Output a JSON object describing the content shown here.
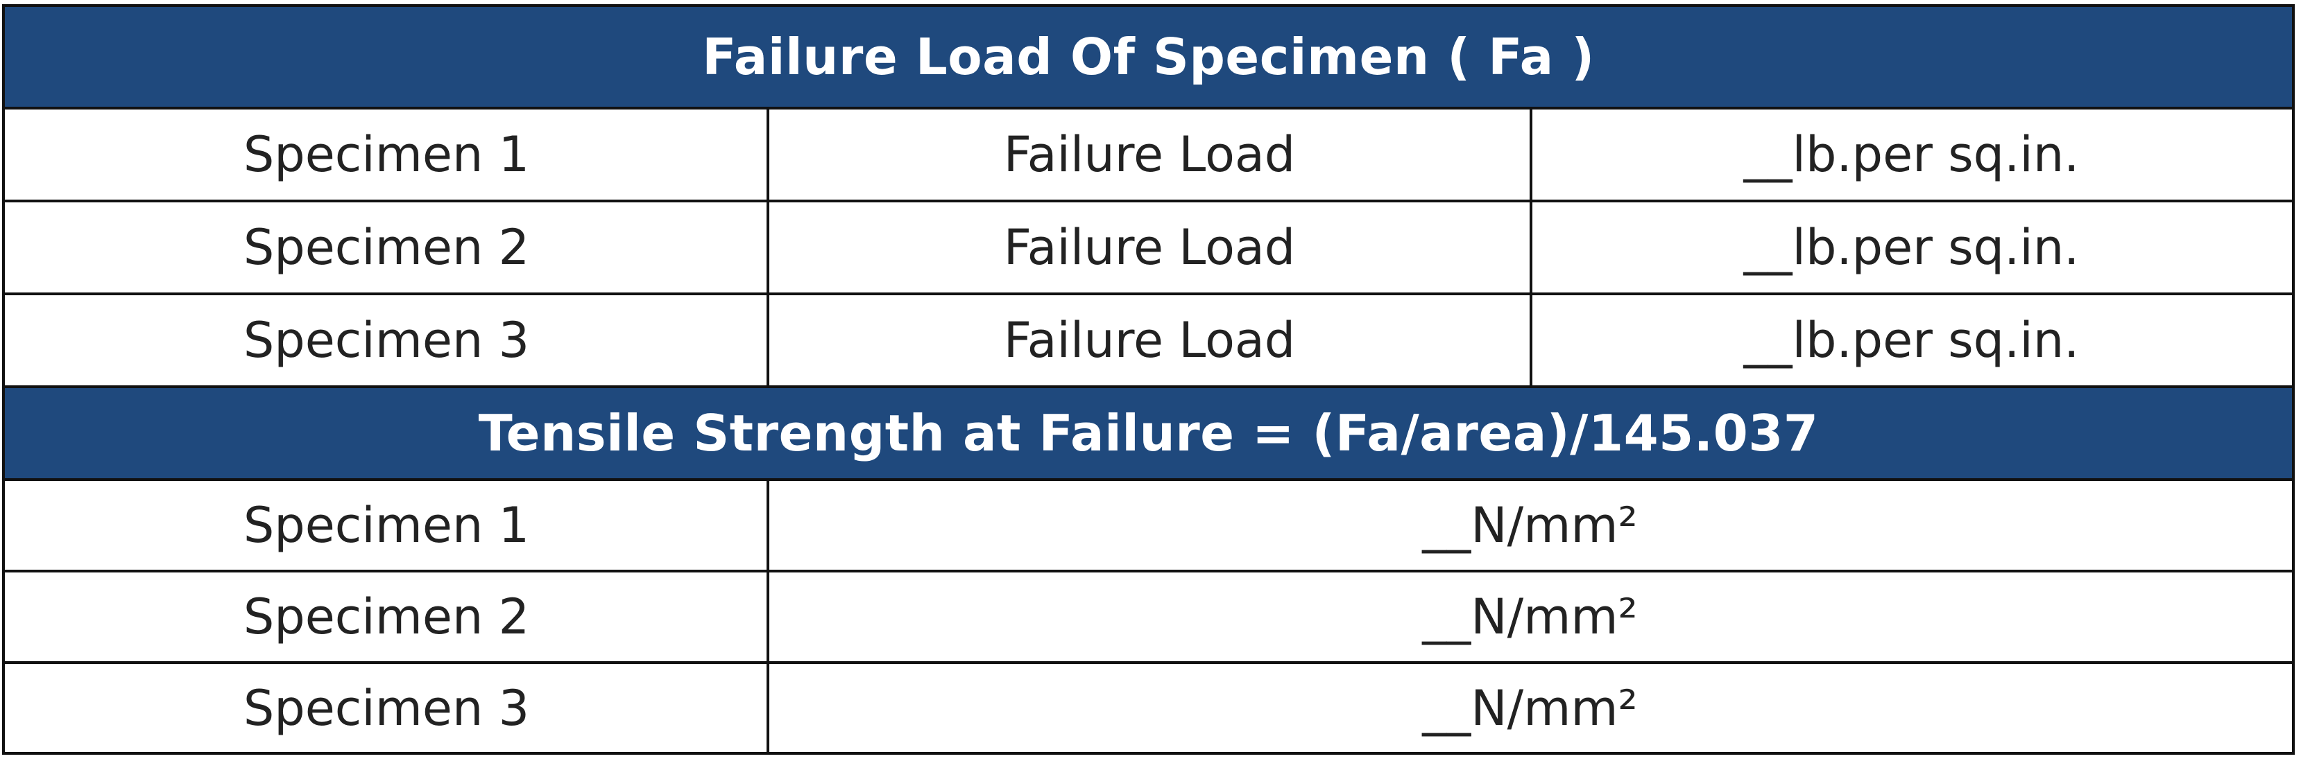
{
  "section1": {
    "title": "Failure Load Of Specimen ( Fa )",
    "rows": [
      {
        "specimen": "Specimen 1",
        "label": "Failure Load",
        "value": "__lb.per sq.in."
      },
      {
        "specimen": "Specimen 2",
        "label": "Failure Load",
        "value": "__lb.per sq.in."
      },
      {
        "specimen": "Specimen 3",
        "label": "Failure Load",
        "value": "__lb.per sq.in."
      }
    ]
  },
  "section2": {
    "title": "Tensile Strength at Failure = (Fa/area)/145.037",
    "rows": [
      {
        "specimen": "Specimen 1",
        "value": "__N/mm²"
      },
      {
        "specimen": "Specimen 2",
        "value": "__N/mm²"
      },
      {
        "specimen": "Specimen 3",
        "value": "__N/mm²"
      }
    ]
  },
  "colors": {
    "header_bg": "#1f497d",
    "header_text": "#ffffff",
    "border": "#111111"
  }
}
